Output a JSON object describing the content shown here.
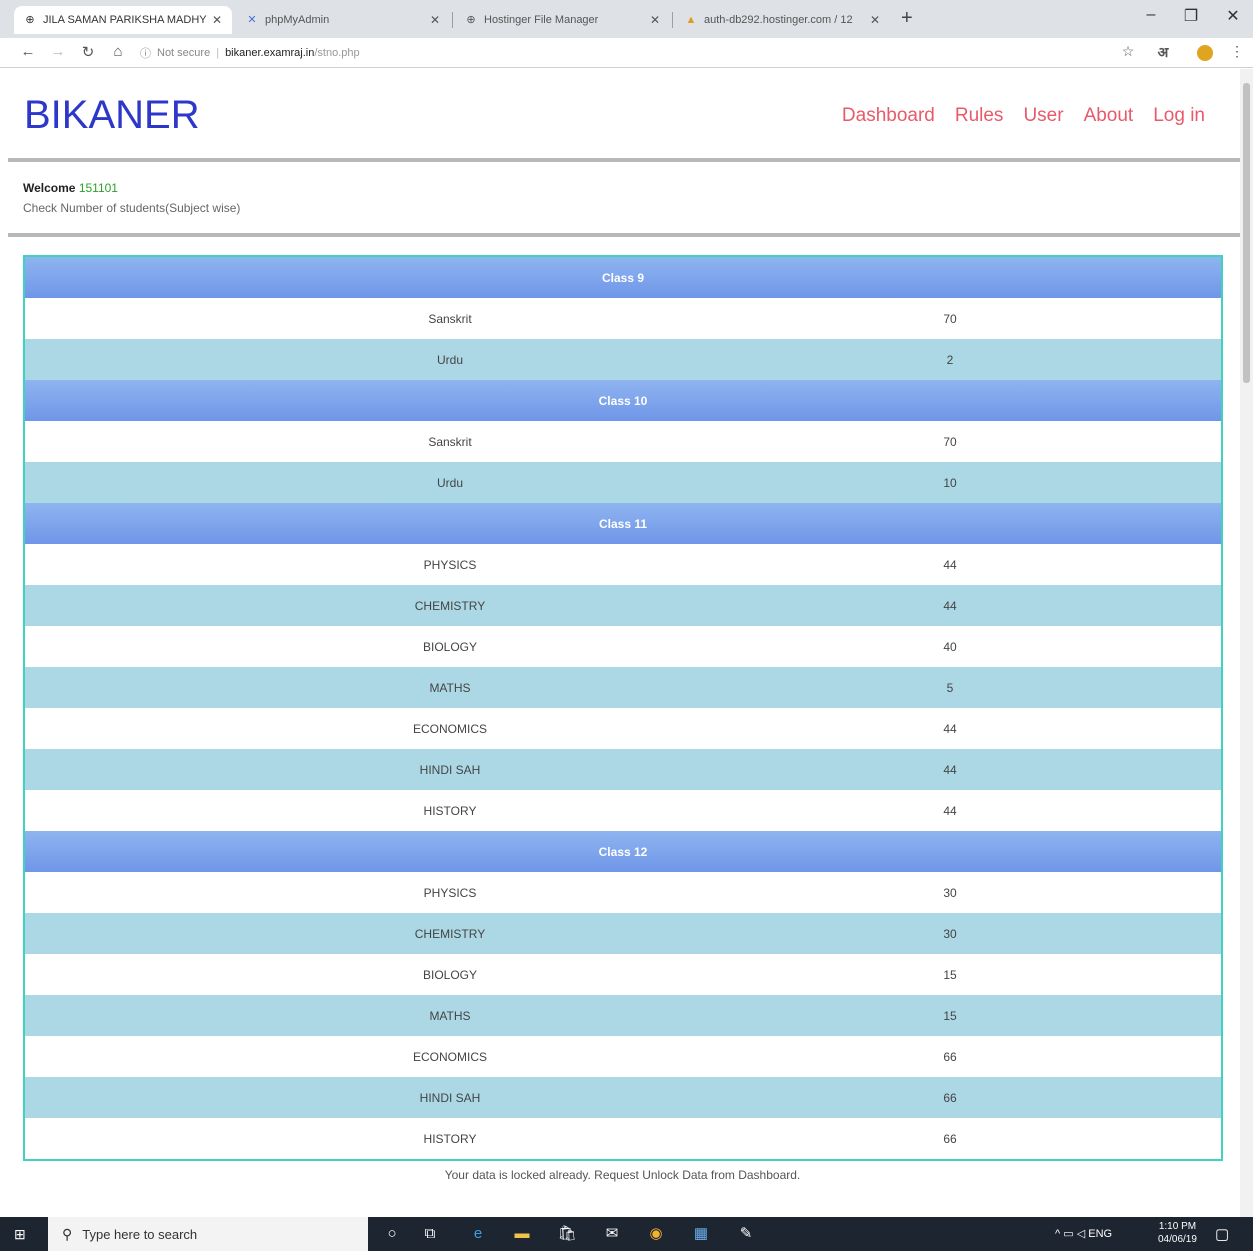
{
  "browser": {
    "tabs": [
      {
        "title": "JILA SAMAN PARIKSHA MADHY",
        "icon": "globe-icon",
        "glyph": "⊕"
      },
      {
        "title": "phpMyAdmin",
        "icon": "phpmyadmin-icon",
        "glyph": "✕"
      },
      {
        "title": "Hostinger File Manager",
        "icon": "globe-icon",
        "glyph": "⊕"
      },
      {
        "title": "auth-db292.hostinger.com / 12",
        "icon": "database-icon",
        "glyph": "▲"
      }
    ],
    "url": {
      "security": "Not secure",
      "host": "bikaner.examraj.in",
      "path": "/stno.php"
    }
  },
  "site": {
    "brand": "BIKANER",
    "nav": [
      "Dashboard",
      "Rules",
      "User",
      "About",
      "Log in"
    ],
    "welcome_label": "Welcome",
    "user_id": "151101",
    "subtitle": "Check Number of students(Subject wise)",
    "notice": "Your data is locked already. Request Unlock Data from Dashboard."
  },
  "rows": [
    {
      "type": "head",
      "label": "Class 9"
    },
    {
      "type": "row",
      "subject": "Sanskrit",
      "count": "70"
    },
    {
      "type": "row",
      "subject": "Urdu",
      "count": "2"
    },
    {
      "type": "head",
      "label": "Class 10"
    },
    {
      "type": "row",
      "subject": "Sanskrit",
      "count": "70"
    },
    {
      "type": "row",
      "subject": "Urdu",
      "count": "10"
    },
    {
      "type": "head",
      "label": "Class 11"
    },
    {
      "type": "row",
      "subject": "PHYSICS",
      "count": "44"
    },
    {
      "type": "row",
      "subject": "CHEMISTRY",
      "count": "44"
    },
    {
      "type": "row",
      "subject": "BIOLOGY",
      "count": "40"
    },
    {
      "type": "row",
      "subject": "MATHS",
      "count": "5"
    },
    {
      "type": "row",
      "subject": "ECONOMICS",
      "count": "44"
    },
    {
      "type": "row",
      "subject": "HINDI SAH",
      "count": "44"
    },
    {
      "type": "row",
      "subject": "HISTORY",
      "count": "44"
    },
    {
      "type": "head",
      "label": "Class 12"
    },
    {
      "type": "row",
      "subject": "PHYSICS",
      "count": "30"
    },
    {
      "type": "row",
      "subject": "CHEMISTRY",
      "count": "30"
    },
    {
      "type": "row",
      "subject": "BIOLOGY",
      "count": "15"
    },
    {
      "type": "row",
      "subject": "MATHS",
      "count": "15"
    },
    {
      "type": "row",
      "subject": "ECONOMICS",
      "count": "66"
    },
    {
      "type": "row",
      "subject": "HINDI SAH",
      "count": "66"
    },
    {
      "type": "row",
      "subject": "HISTORY",
      "count": "66"
    }
  ],
  "taskbar": {
    "search_placeholder": "Type here to search",
    "lang": "ENG",
    "time": "1:10 PM",
    "date": "04/06/19"
  },
  "colors": {
    "brand": "#2d37c9",
    "nav": "#e85a6a",
    "table_border": "#3fd3bf",
    "row_alt": "#acd8e6",
    "class_header": "#7ba1eb"
  }
}
